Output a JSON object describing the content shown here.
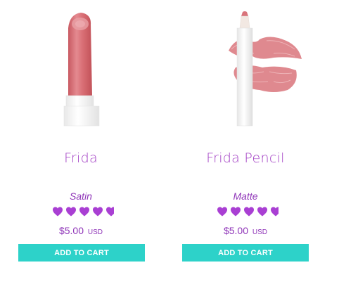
{
  "products": [
    {
      "name": "Frida",
      "finish": "Satin",
      "rating": 4.5,
      "price": "$5.00",
      "currency": "USD",
      "cart_label": "ADD TO CART",
      "image_icon": "lipstick-bullet",
      "color": "#d96e75"
    },
    {
      "name": "Frida Pencil",
      "finish": "Matte",
      "rating": 4.5,
      "price": "$5.00",
      "currency": "USD",
      "cart_label": "ADD TO CART",
      "image_icon": "lip-pencil-with-kiss-swatch",
      "color": "#d96e75"
    }
  ],
  "colors": {
    "accent_purple": "#a23ec4",
    "cart_button": "#2dd2c9",
    "heart": "#a93fd3"
  }
}
